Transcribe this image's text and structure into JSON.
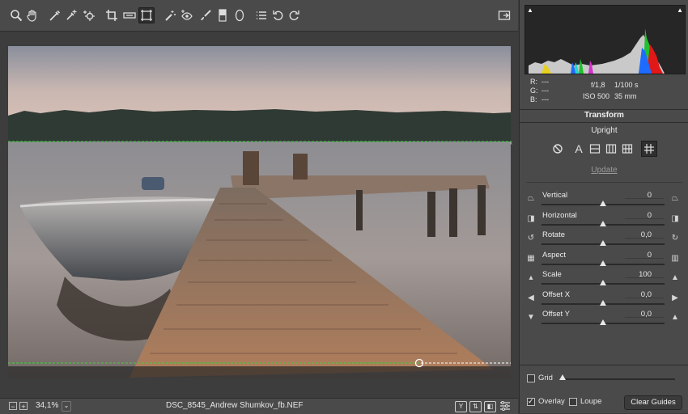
{
  "toolbar": {
    "tools": [
      {
        "name": "zoom-tool",
        "icon": "magnifier-icon"
      },
      {
        "name": "hand-tool",
        "icon": "hand-icon"
      },
      {
        "name": "white-balance-tool",
        "icon": "eyedropper-icon"
      },
      {
        "name": "color-sampler-tool",
        "icon": "eyedropper-plus-icon"
      },
      {
        "name": "targeted-adjustment-tool",
        "icon": "target-icon"
      },
      {
        "name": "crop-tool",
        "icon": "crop-icon"
      },
      {
        "name": "straighten-tool",
        "icon": "level-icon"
      },
      {
        "name": "transform-tool",
        "icon": "transform-icon",
        "active": true
      },
      {
        "name": "spot-removal-tool",
        "icon": "brush-spot-icon"
      },
      {
        "name": "red-eye-tool",
        "icon": "red-eye-icon"
      },
      {
        "name": "adjustment-brush-tool",
        "icon": "brush-icon"
      },
      {
        "name": "graduated-filter-tool",
        "icon": "graduated-filter-icon"
      },
      {
        "name": "radial-filter-tool",
        "icon": "radial-filter-icon"
      },
      {
        "name": "preferences-tool",
        "icon": "list-icon"
      },
      {
        "name": "rotate-left-tool",
        "icon": "rotate-ccw-icon"
      },
      {
        "name": "rotate-right-tool",
        "icon": "rotate-cw-icon"
      }
    ],
    "export_icon": "fullscreen-toggle-icon"
  },
  "status": {
    "zoom_out": "−",
    "zoom_in": "+",
    "zoom": "34,1%",
    "zoom_dropdown": "⌄",
    "filename": "DSC_8545_Andrew Shumkov_fb.NEF",
    "compare_mode": "Y",
    "icons": [
      "compare-icon",
      "swap-icon",
      "toggle-icon",
      "settings-sliders-icon"
    ]
  },
  "readout": {
    "r_label": "R:",
    "r_value": "---",
    "g_label": "G:",
    "g_value": "---",
    "b_label": "B:",
    "b_value": "---",
    "aperture": "f/1,8",
    "shutter": "1/100 s",
    "iso": "ISO 500",
    "focal": "35 mm"
  },
  "panel": {
    "section_title": "Transform",
    "upright_label": "Upright",
    "upright_buttons": [
      "off-icon",
      "auto-icon",
      "level-icon",
      "vertical-icon",
      "full-icon",
      "guided-icon"
    ],
    "update_label": "Update",
    "sliders": [
      {
        "label": "Vertical",
        "value": "0",
        "position": 0.5,
        "left_icon": "vertical-perspective-icon",
        "right_icon": "vertical-perspective-icon"
      },
      {
        "label": "Horizontal",
        "value": "0",
        "position": 0.5,
        "left_icon": "horizontal-perspective-icon",
        "right_icon": "horizontal-perspective-icon"
      },
      {
        "label": "Rotate",
        "value": "0,0",
        "position": 0.5,
        "left_icon": "rotate-ccw-icon",
        "right_icon": "rotate-cw-icon"
      },
      {
        "label": "Aspect",
        "value": "0",
        "position": 0.5,
        "left_icon": "aspect-wide-icon",
        "right_icon": "aspect-tall-icon"
      },
      {
        "label": "Scale",
        "value": "100",
        "position": 0.5,
        "left_icon": "scale-small-icon",
        "right_icon": "scale-large-icon"
      },
      {
        "label": "Offset X",
        "value": "0,0",
        "position": 0.5,
        "left_icon": "arrow-left-icon",
        "right_icon": "arrow-right-icon"
      },
      {
        "label": "Offset Y",
        "value": "0,0",
        "position": 0.5,
        "left_icon": "arrow-down-icon",
        "right_icon": "arrow-up-icon"
      }
    ],
    "grid_label": "Grid",
    "grid_checked": false,
    "overlay_label": "Overlay",
    "overlay_checked": true,
    "loupe_label": "Loupe",
    "loupe_checked": false,
    "clear_guides_label": "Clear Guides"
  },
  "colors": {
    "guide_line": "#39d339",
    "panel_bg": "#4a4a4a",
    "canvas_bg": "#3d3d3d",
    "histogram_bg": "#262626"
  }
}
